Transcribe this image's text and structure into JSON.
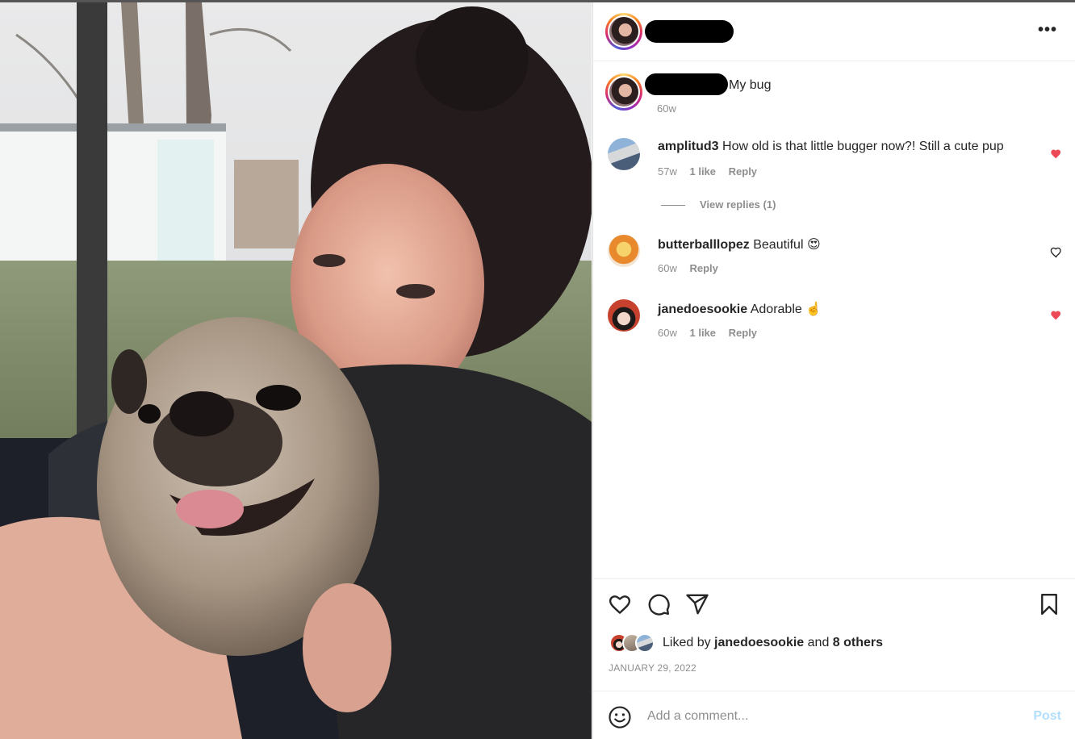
{
  "post": {
    "image_alt": "",
    "header": {
      "username_redacted": true,
      "more_icon": "more-horizontal-icon",
      "more_label": "•••"
    },
    "caption": {
      "text": "My bug",
      "time": "60w"
    },
    "comments": [
      {
        "username": "amplitud3",
        "text": "How old is that little bugger now?! Still a cute pup",
        "time": "57w",
        "likes": "1 like",
        "reply": "Reply",
        "liked": true
      },
      {
        "username": "butterballlopez",
        "text": "Beautiful",
        "emoji": "😍",
        "time": "60w",
        "likes": "",
        "reply": "Reply",
        "liked": false
      },
      {
        "username": "janedoesookie",
        "text": "Adorable",
        "emoji": "☝️",
        "time": "60w",
        "likes": "1 like",
        "reply": "Reply",
        "liked": true
      }
    ],
    "view_replies": "View replies (1)",
    "likes_summary": {
      "prefix": "Liked by ",
      "user": "janedoesookie",
      "middle": " and ",
      "others": "8 others"
    },
    "date": "JANUARY 29, 2022",
    "add_comment": {
      "placeholder": "Add a comment...",
      "post_label": "Post"
    },
    "colors": {
      "liked_heart": "#ed4956",
      "post_disabled": "#b2dffc",
      "muted_text": "#8e8e8e"
    }
  }
}
